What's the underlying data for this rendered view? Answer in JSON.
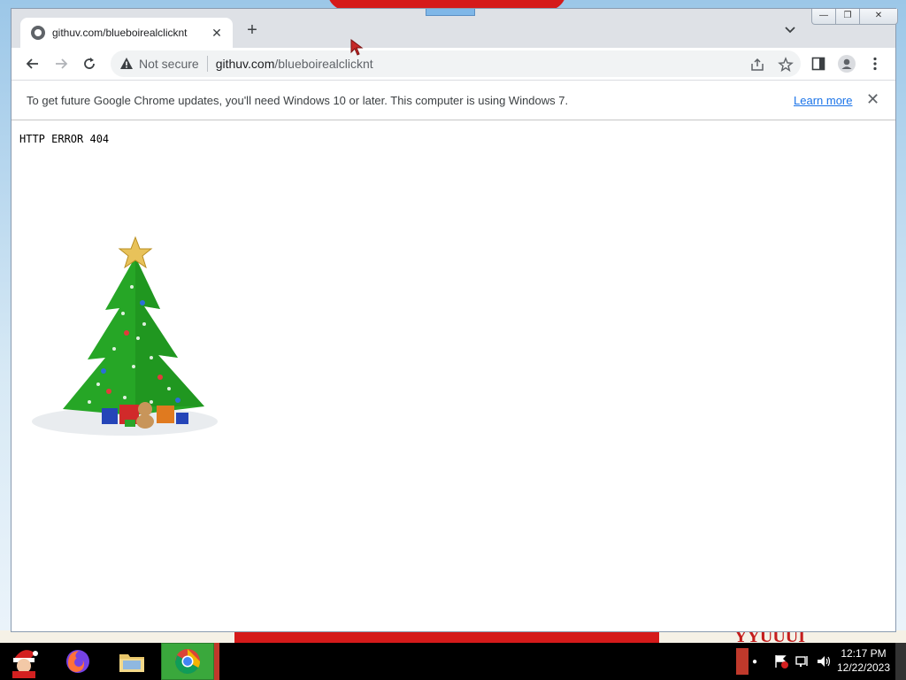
{
  "window": {
    "tab_title": "githuv.com/blueboirealclicknt",
    "tab_close": "✕",
    "new_tab": "+",
    "min": "—",
    "max": "❐",
    "close": "✕"
  },
  "toolbar": {
    "security_label": "Not secure",
    "url_domain": "githuv.com",
    "url_path": "/blueboirealclicknt"
  },
  "infobar": {
    "message": "To get future Google Chrome updates, you'll need Windows 10 or later. This computer is using Windows 7.",
    "learn_more": "Learn more",
    "close": "✕"
  },
  "page": {
    "error_text": "HTTP ERROR 404"
  },
  "taskbar": {
    "time": "12:17 PM",
    "date": "12/22/2023"
  },
  "wallpaper": {
    "text": "YYUUUI"
  },
  "colors": {
    "tab_strip": "#dee1e6",
    "omnibox": "#f1f3f4",
    "link": "#1a73e8",
    "taskbar_active": "#3aa83c"
  }
}
